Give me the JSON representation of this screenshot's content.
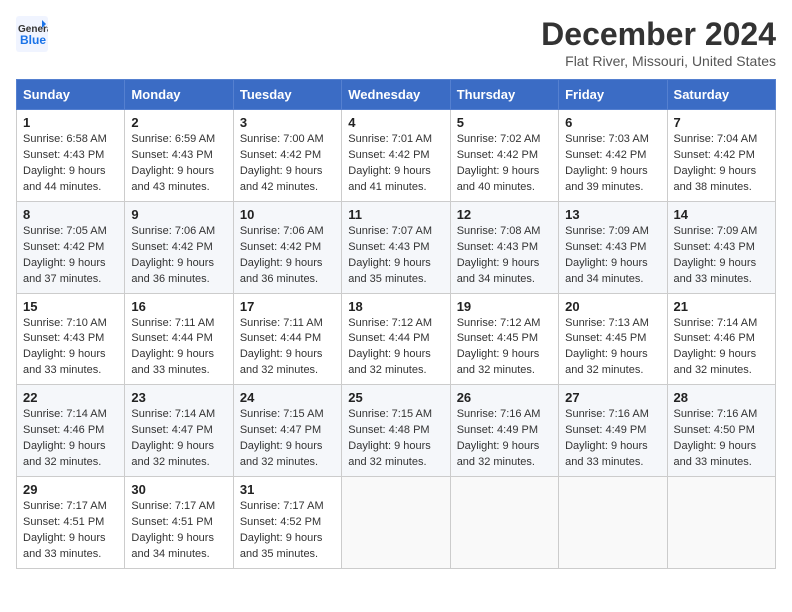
{
  "header": {
    "logo_line1": "General",
    "logo_line2": "Blue",
    "main_title": "December 2024",
    "subtitle": "Flat River, Missouri, United States"
  },
  "days_of_week": [
    "Sunday",
    "Monday",
    "Tuesday",
    "Wednesday",
    "Thursday",
    "Friday",
    "Saturday"
  ],
  "weeks": [
    [
      {
        "day": "1",
        "sunrise": "6:58 AM",
        "sunset": "4:43 PM",
        "daylight": "9 hours and 44 minutes."
      },
      {
        "day": "2",
        "sunrise": "6:59 AM",
        "sunset": "4:43 PM",
        "daylight": "9 hours and 43 minutes."
      },
      {
        "day": "3",
        "sunrise": "7:00 AM",
        "sunset": "4:42 PM",
        "daylight": "9 hours and 42 minutes."
      },
      {
        "day": "4",
        "sunrise": "7:01 AM",
        "sunset": "4:42 PM",
        "daylight": "9 hours and 41 minutes."
      },
      {
        "day": "5",
        "sunrise": "7:02 AM",
        "sunset": "4:42 PM",
        "daylight": "9 hours and 40 minutes."
      },
      {
        "day": "6",
        "sunrise": "7:03 AM",
        "sunset": "4:42 PM",
        "daylight": "9 hours and 39 minutes."
      },
      {
        "day": "7",
        "sunrise": "7:04 AM",
        "sunset": "4:42 PM",
        "daylight": "9 hours and 38 minutes."
      }
    ],
    [
      {
        "day": "8",
        "sunrise": "7:05 AM",
        "sunset": "4:42 PM",
        "daylight": "9 hours and 37 minutes."
      },
      {
        "day": "9",
        "sunrise": "7:06 AM",
        "sunset": "4:42 PM",
        "daylight": "9 hours and 36 minutes."
      },
      {
        "day": "10",
        "sunrise": "7:06 AM",
        "sunset": "4:42 PM",
        "daylight": "9 hours and 36 minutes."
      },
      {
        "day": "11",
        "sunrise": "7:07 AM",
        "sunset": "4:43 PM",
        "daylight": "9 hours and 35 minutes."
      },
      {
        "day": "12",
        "sunrise": "7:08 AM",
        "sunset": "4:43 PM",
        "daylight": "9 hours and 34 minutes."
      },
      {
        "day": "13",
        "sunrise": "7:09 AM",
        "sunset": "4:43 PM",
        "daylight": "9 hours and 34 minutes."
      },
      {
        "day": "14",
        "sunrise": "7:09 AM",
        "sunset": "4:43 PM",
        "daylight": "9 hours and 33 minutes."
      }
    ],
    [
      {
        "day": "15",
        "sunrise": "7:10 AM",
        "sunset": "4:43 PM",
        "daylight": "9 hours and 33 minutes."
      },
      {
        "day": "16",
        "sunrise": "7:11 AM",
        "sunset": "4:44 PM",
        "daylight": "9 hours and 33 minutes."
      },
      {
        "day": "17",
        "sunrise": "7:11 AM",
        "sunset": "4:44 PM",
        "daylight": "9 hours and 32 minutes."
      },
      {
        "day": "18",
        "sunrise": "7:12 AM",
        "sunset": "4:44 PM",
        "daylight": "9 hours and 32 minutes."
      },
      {
        "day": "19",
        "sunrise": "7:12 AM",
        "sunset": "4:45 PM",
        "daylight": "9 hours and 32 minutes."
      },
      {
        "day": "20",
        "sunrise": "7:13 AM",
        "sunset": "4:45 PM",
        "daylight": "9 hours and 32 minutes."
      },
      {
        "day": "21",
        "sunrise": "7:14 AM",
        "sunset": "4:46 PM",
        "daylight": "9 hours and 32 minutes."
      }
    ],
    [
      {
        "day": "22",
        "sunrise": "7:14 AM",
        "sunset": "4:46 PM",
        "daylight": "9 hours and 32 minutes."
      },
      {
        "day": "23",
        "sunrise": "7:14 AM",
        "sunset": "4:47 PM",
        "daylight": "9 hours and 32 minutes."
      },
      {
        "day": "24",
        "sunrise": "7:15 AM",
        "sunset": "4:47 PM",
        "daylight": "9 hours and 32 minutes."
      },
      {
        "day": "25",
        "sunrise": "7:15 AM",
        "sunset": "4:48 PM",
        "daylight": "9 hours and 32 minutes."
      },
      {
        "day": "26",
        "sunrise": "7:16 AM",
        "sunset": "4:49 PM",
        "daylight": "9 hours and 32 minutes."
      },
      {
        "day": "27",
        "sunrise": "7:16 AM",
        "sunset": "4:49 PM",
        "daylight": "9 hours and 33 minutes."
      },
      {
        "day": "28",
        "sunrise": "7:16 AM",
        "sunset": "4:50 PM",
        "daylight": "9 hours and 33 minutes."
      }
    ],
    [
      {
        "day": "29",
        "sunrise": "7:17 AM",
        "sunset": "4:51 PM",
        "daylight": "9 hours and 33 minutes."
      },
      {
        "day": "30",
        "sunrise": "7:17 AM",
        "sunset": "4:51 PM",
        "daylight": "9 hours and 34 minutes."
      },
      {
        "day": "31",
        "sunrise": "7:17 AM",
        "sunset": "4:52 PM",
        "daylight": "9 hours and 35 minutes."
      },
      null,
      null,
      null,
      null
    ]
  ],
  "labels": {
    "sunrise": "Sunrise:",
    "sunset": "Sunset:",
    "daylight": "Daylight:"
  }
}
